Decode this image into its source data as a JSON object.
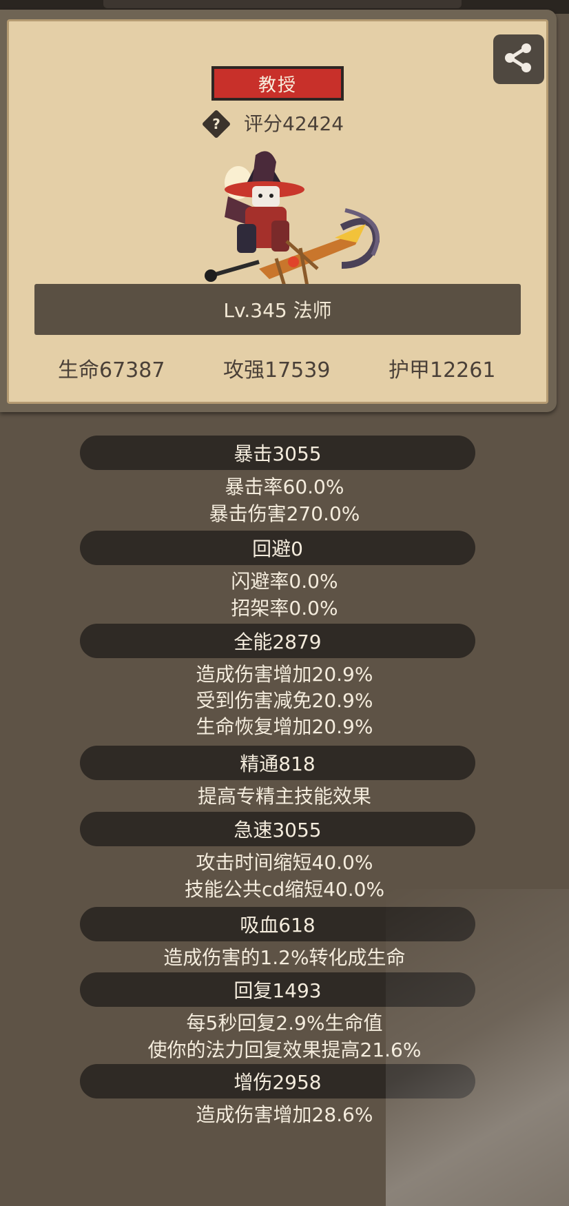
{
  "header": {
    "title_badge": "教授",
    "score": "评分42424",
    "level": "Lv.345 法师",
    "stats": [
      "生命67387",
      "攻强17539",
      "护甲12261"
    ]
  },
  "icons": {
    "share": "share-icon",
    "help": "question-diamond-icon"
  },
  "help_glyph": "?",
  "sections": [
    {
      "title": "暴击3055",
      "lines": [
        "暴击率60.0%",
        "暴击伤害270.0%"
      ]
    },
    {
      "title": "回避0",
      "lines": [
        "闪避率0.0%",
        "招架率0.0%"
      ]
    },
    {
      "title": "全能2879",
      "lines": [
        "造成伤害增加20.9%",
        "受到伤害减免20.9%",
        "生命恢复增加20.9%"
      ]
    },
    {
      "title": "精通818",
      "lines": [
        "提高专精主技能效果"
      ]
    },
    {
      "title": "急速3055",
      "lines": [
        "攻击时间缩短40.0%",
        "技能公共cd缩短40.0%"
      ]
    },
    {
      "title": "吸血618",
      "lines": [
        "造成伤害的1.2%转化成生命"
      ]
    },
    {
      "title": "回复1493",
      "lines": [
        "每5秒回复2.9%生命值",
        "使你的法力回复效果提高21.6%"
      ]
    },
    {
      "title": "增伤2958",
      "lines": [
        "造成伤害增加28.6%"
      ]
    }
  ],
  "colors": {
    "badge": "#c8302a",
    "panel": "#e4cfa7",
    "background": "#5e5346",
    "pill": "#2f2a25"
  }
}
